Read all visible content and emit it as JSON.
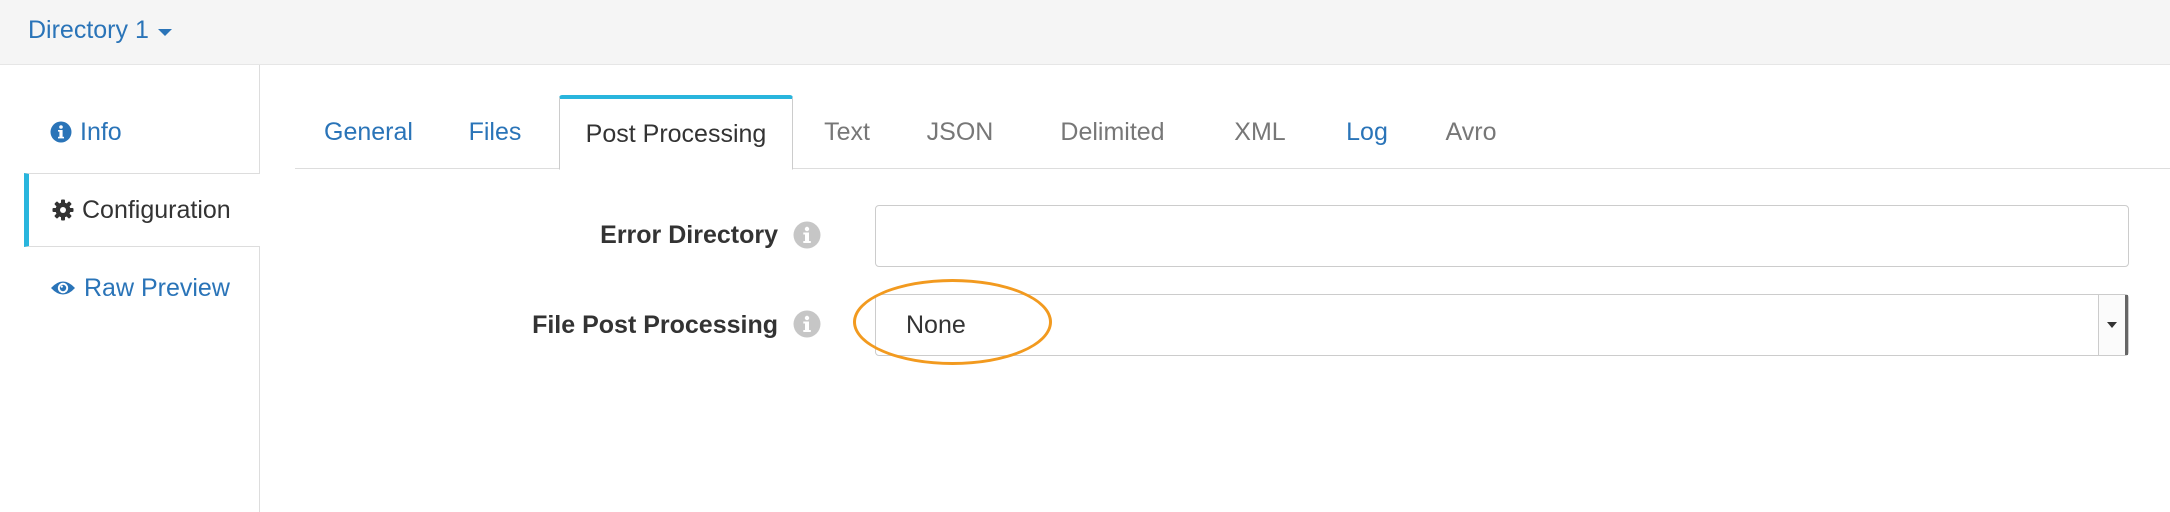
{
  "header": {
    "directory_label": "Directory 1"
  },
  "sidebar": {
    "items": [
      {
        "label": "Info",
        "icon": "info-circle-icon"
      },
      {
        "label": "Configuration",
        "icon": "gear-icon",
        "active": true
      },
      {
        "label": "Raw Preview",
        "icon": "eye-icon"
      }
    ]
  },
  "tabs": [
    {
      "label": "General"
    },
    {
      "label": "Files"
    },
    {
      "label": "Post Processing",
      "active": true
    },
    {
      "label": "Text"
    },
    {
      "label": "JSON"
    },
    {
      "label": "Delimited"
    },
    {
      "label": "XML"
    },
    {
      "label": "Log"
    },
    {
      "label": "Avro"
    }
  ],
  "form": {
    "error_directory": {
      "label": "Error Directory",
      "value": "",
      "placeholder": ""
    },
    "file_post_processing": {
      "label": "File Post Processing",
      "value": "None"
    }
  },
  "colors": {
    "link": "#2a74b8",
    "accent": "#29b5dd",
    "highlight": "#f29a1f",
    "muted_tab": "#777777"
  }
}
